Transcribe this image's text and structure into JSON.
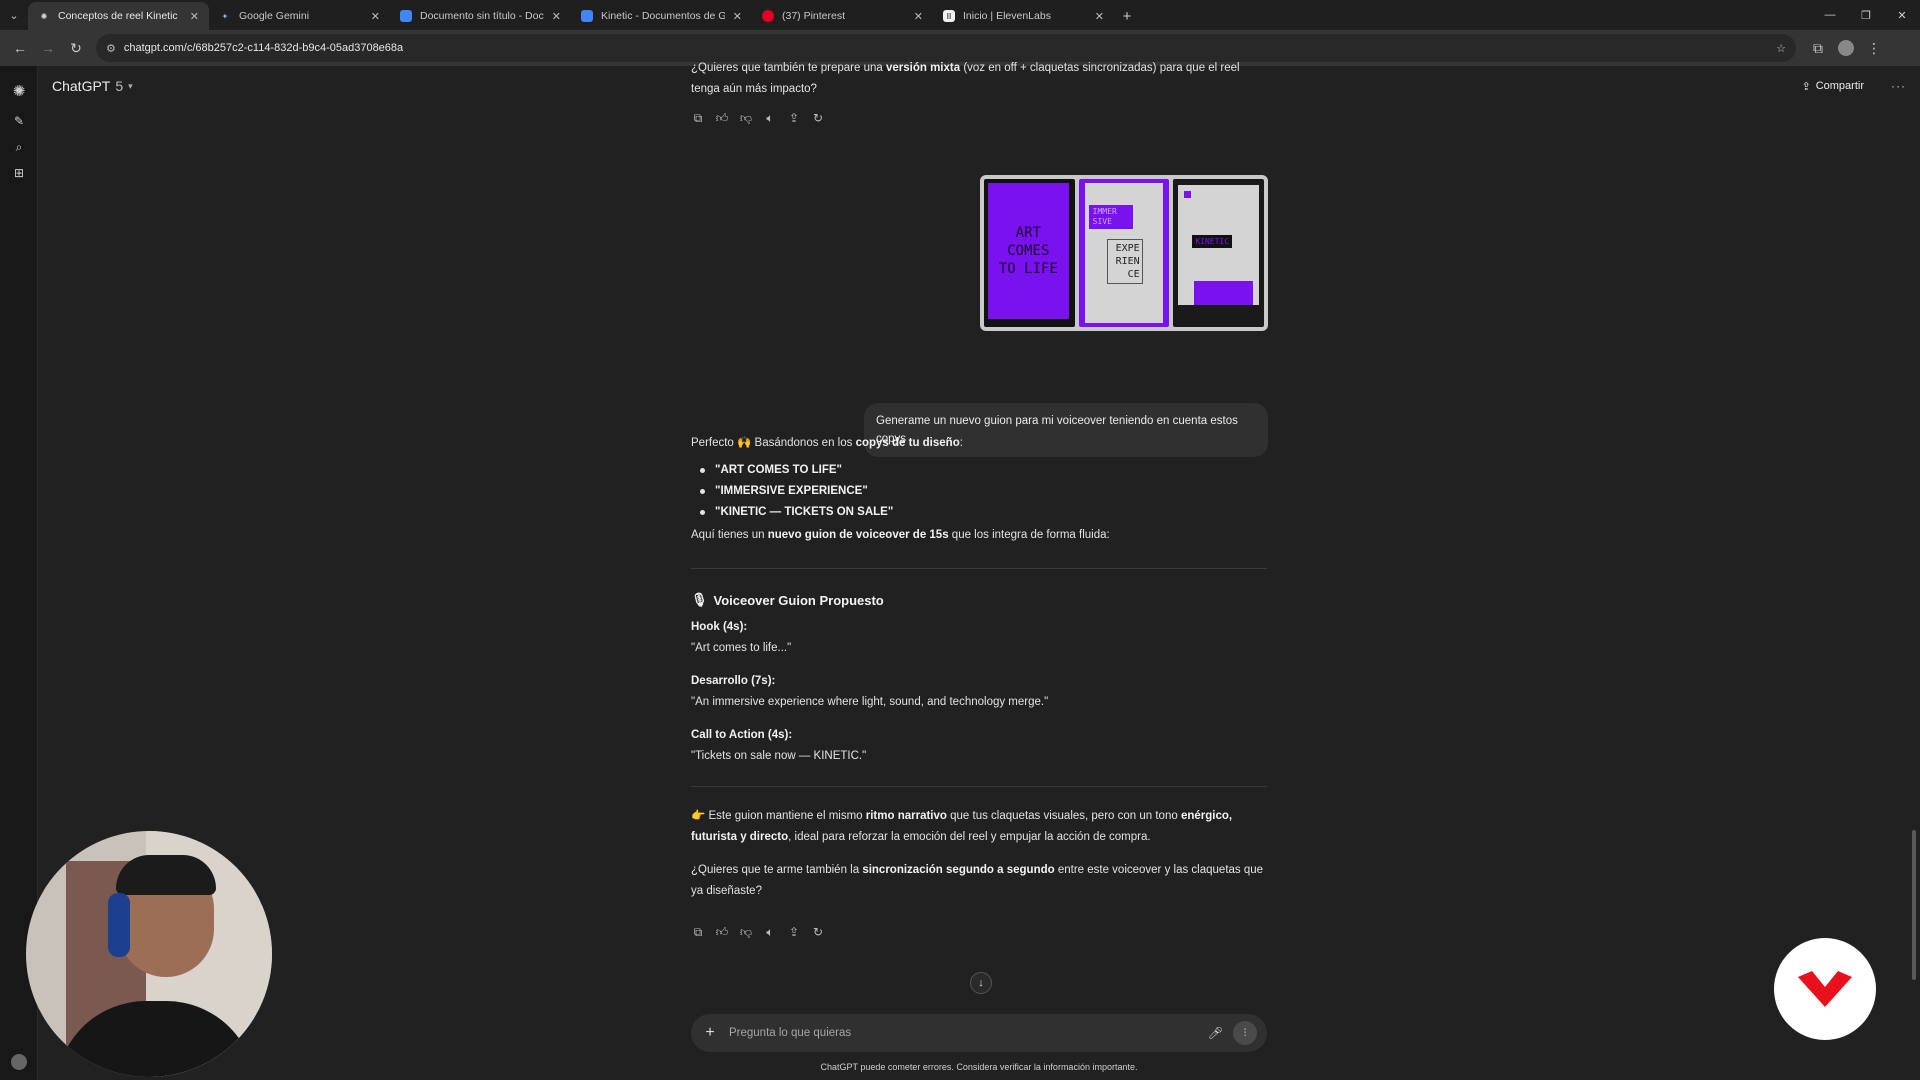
{
  "browser": {
    "tabs": [
      {
        "title": "Conceptos de reel Kinetic",
        "active": true
      },
      {
        "title": "Google Gemini",
        "active": false
      },
      {
        "title": "Documento sin título - Docume",
        "active": false
      },
      {
        "title": "Kinetic - Documentos de Goog",
        "active": false
      },
      {
        "title": "(37) Pinterest",
        "active": false
      },
      {
        "title": "Inicio | ElevenLabs",
        "active": false
      }
    ],
    "url": "chatgpt.com/c/68b257c2-c114-832d-b9c4-05ad3708e68a"
  },
  "header": {
    "model_name": "ChatGPT",
    "model_version": "5",
    "share_label": "Compartir"
  },
  "top_message": {
    "part1": "¿Quieres que también te prepare una ",
    "bold1": "versión mixta",
    "part2": " (voz en off + claquetas sincronizadas) para que el reel tenga aún más impacto?"
  },
  "attachment_panels": {
    "panel1_text": "ART COMES TO LIFE",
    "panel2_tag": "IMMER SIVE",
    "panel2_text": "EXPE RIEN CE",
    "panel3_tag": "KINETIC"
  },
  "user_message": "Generame un nuevo guion para mi voiceover teniendo en cuenta estos copys",
  "response": {
    "intro_part1": "Perfecto 🙌 Basándonos en los ",
    "intro_bold": "copys de tu diseño",
    "intro_part2": ":",
    "copies": [
      "\"ART COMES TO LIFE\"",
      "\"IMMERSIVE EXPERIENCE\"",
      "\"KINETIC — TICKETS ON SALE\""
    ],
    "lead_part1": "Aquí tienes un ",
    "lead_bold": "nuevo guion de voiceover de 15s",
    "lead_part2": " que los integra de forma fluida:",
    "section_title": "Voiceover Guion Propuesto",
    "blocks": [
      {
        "label": "Hook (4s):",
        "text": "\"Art comes to life...\""
      },
      {
        "label": "Desarrollo (7s):",
        "text": "\"An immersive experience where light, sound, and technology merge.\""
      },
      {
        "label": "Call to Action (4s):",
        "text": "\"Tickets on sale now — KINETIC.\""
      }
    ],
    "closing_part1": "👉 Este guion mantiene el mismo ",
    "closing_bold1": "ritmo narrativo",
    "closing_part2": " que tus claquetas visuales, pero con un tono ",
    "closing_bold2": "enérgico, futurista y directo",
    "closing_part3": ", ideal para reforzar la emoción del reel y empujar la acción de compra.",
    "question_part1": "¿Quieres que te arme también la ",
    "question_bold": "sincronización segundo a segundo",
    "question_part2": " entre este voiceover y las claquetas que ya diseñaste?"
  },
  "composer": {
    "placeholder": "Pregunta lo que quieras"
  },
  "disclaimer": "ChatGPT puede cometer errores. Considera verificar la información importante.",
  "icons": [
    "chatgpt-logo-icon",
    "new-chat-icon",
    "search-icon",
    "library-icon",
    "copy-icon",
    "thumbs-up-icon",
    "thumbs-down-icon",
    "read-aloud-icon",
    "share-icon",
    "regenerate-icon",
    "mic-icon",
    "voice-mode-icon",
    "plus-icon"
  ],
  "colors": {
    "accent_purple": "#7a12f0",
    "background": "#212121",
    "bubble": "#303030",
    "brand_red": "#e8101c"
  }
}
